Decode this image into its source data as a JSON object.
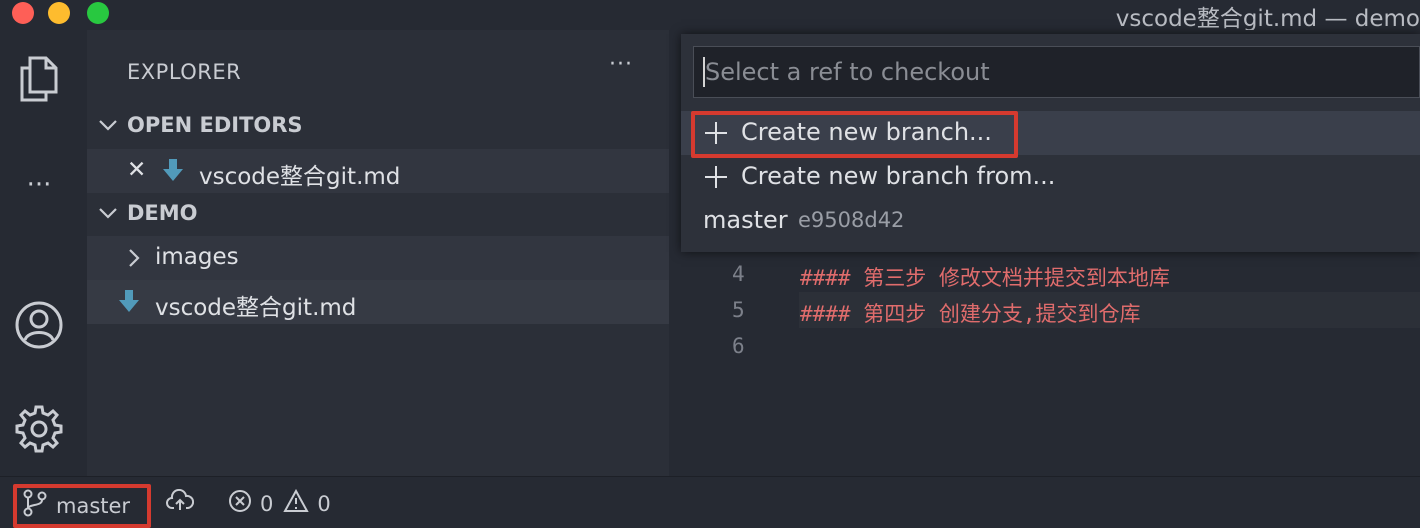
{
  "window": {
    "title": "vscode整合git.md — demo"
  },
  "activity_bar": {
    "items": [
      {
        "name": "explorer-icon"
      },
      {
        "name": "more-icon",
        "glyph": "···"
      },
      {
        "name": "account-icon"
      },
      {
        "name": "manage-gear-icon"
      }
    ]
  },
  "sidebar": {
    "title": "EXPLORER",
    "more": "···",
    "open_editors": {
      "label": "OPEN EDITORS",
      "items": [
        {
          "close": "✕",
          "name": "vscode整合git.md",
          "icon": "markdown-arrow-icon"
        }
      ]
    },
    "folder": {
      "label": "DEMO",
      "items": [
        {
          "name": "images",
          "type": "folder"
        },
        {
          "name": "vscode整合git.md",
          "type": "file",
          "icon": "markdown-arrow-icon"
        }
      ]
    }
  },
  "quick_pick": {
    "placeholder": "Select a ref to checkout",
    "items": [
      {
        "label": "Create new branch...",
        "selected": true
      },
      {
        "label": "Create new branch from...",
        "selected": false
      },
      {
        "label": "master",
        "description": "e9508d42"
      }
    ]
  },
  "editor": {
    "lines": [
      {
        "num": "4",
        "text": "#### 第三步 修改文档并提交到本地库"
      },
      {
        "num": "5",
        "text": "#### 第四步 创建分支,提交到仓库"
      },
      {
        "num": "6",
        "text": ""
      }
    ]
  },
  "status_bar": {
    "branch": "master",
    "errors": "0",
    "warnings": "0"
  },
  "colors": {
    "accent_red": "#d53a2f",
    "markdown_icon": "#519aba",
    "heading_text": "#e06c6c"
  }
}
